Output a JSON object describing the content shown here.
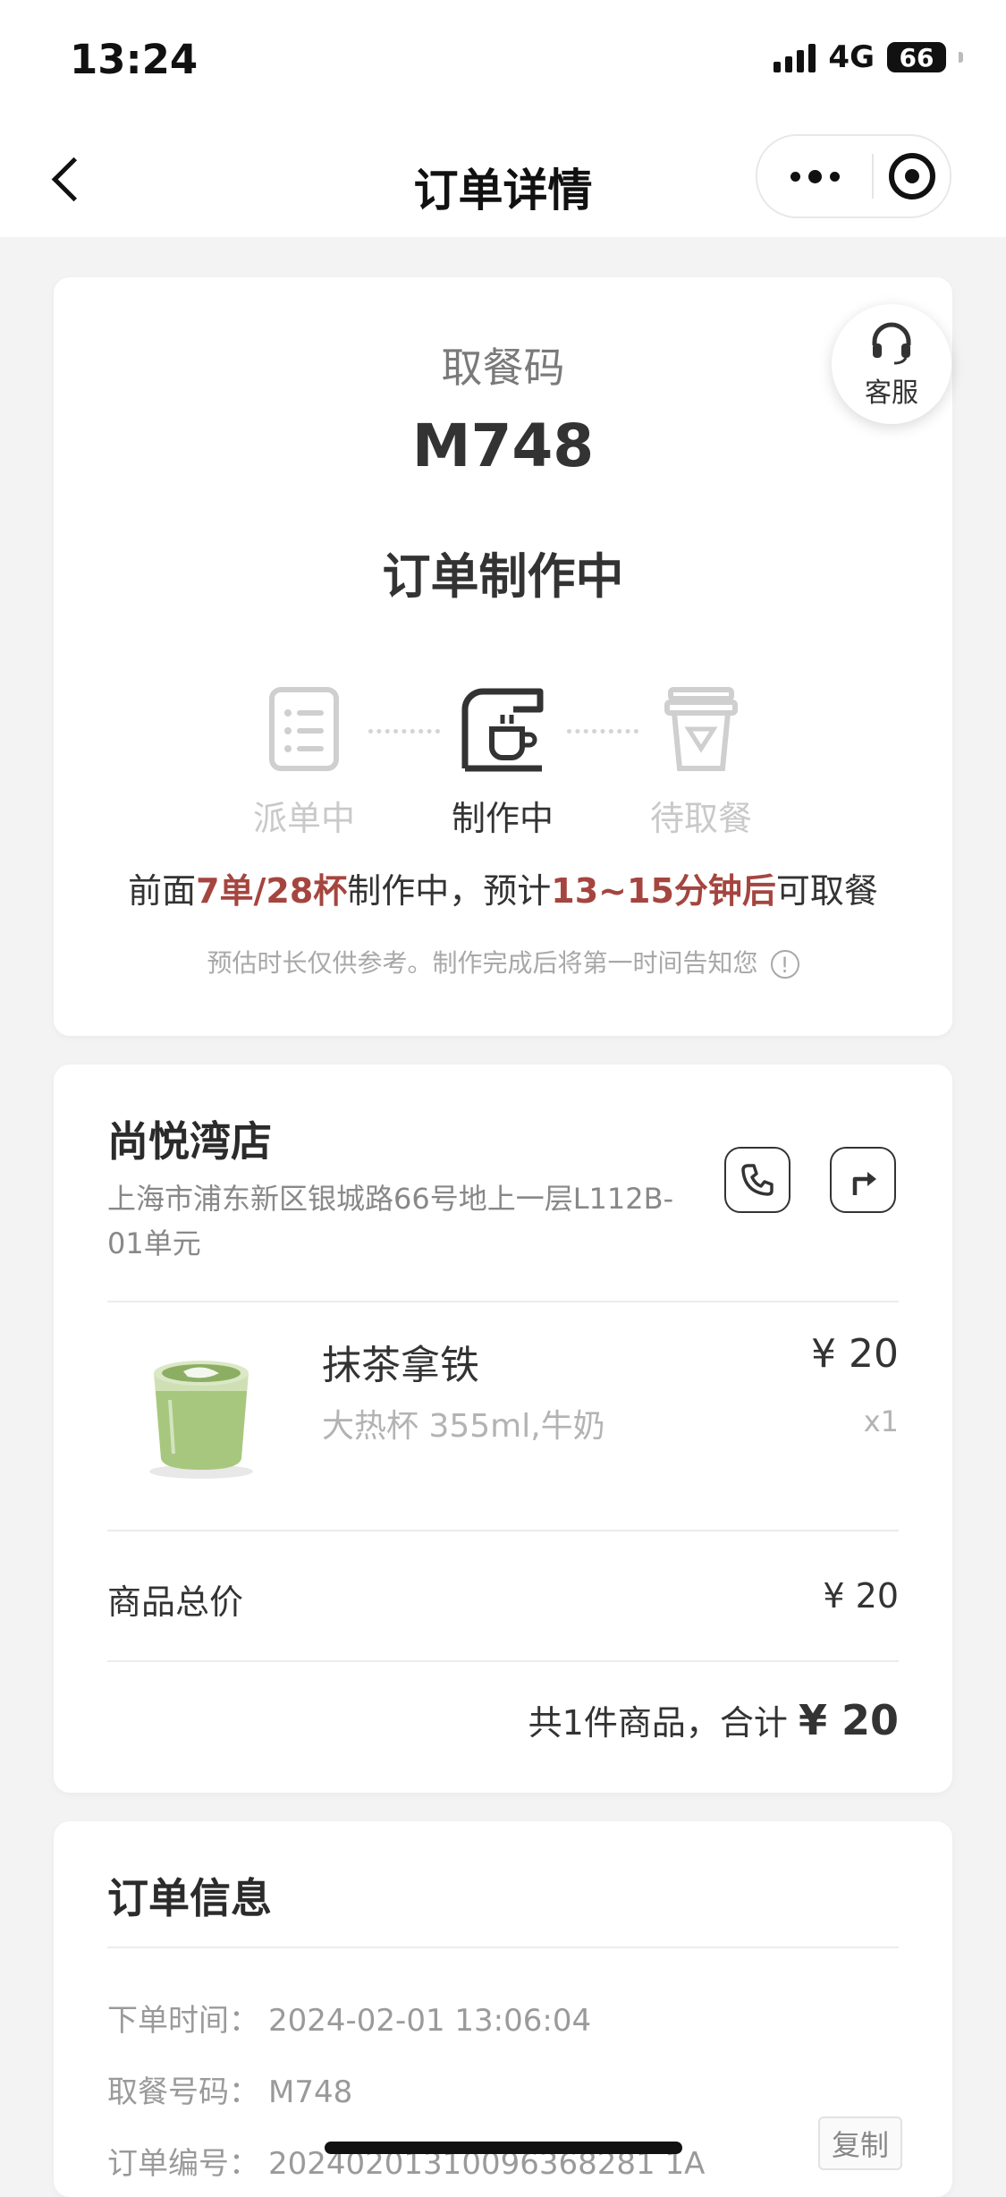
{
  "status_bar": {
    "time": "13:24",
    "network": "4G",
    "battery": "66"
  },
  "nav": {
    "title": "订单详情",
    "back_icon": "chevron-left-icon",
    "more_icon": "more-dots-icon",
    "close_icon": "target-close-icon"
  },
  "pickup": {
    "label": "取餐码",
    "code": "M748",
    "status": "订单制作中",
    "service_label": "客服",
    "service_icon": "headset-icon"
  },
  "steps": [
    {
      "label": "派单中",
      "icon": "order-list-icon",
      "active": false
    },
    {
      "label": "制作中",
      "icon": "coffee-machine-icon",
      "active": true
    },
    {
      "label": "待取餐",
      "icon": "cup-icon",
      "active": false
    }
  ],
  "queue": {
    "prefix": "前面",
    "orders": "7单/28杯",
    "middle": "制作中，预计",
    "eta": "13~15分钟后",
    "suffix": "可取餐",
    "note": "预估时长仅供参考。制作完成后将第一时间告知您",
    "highlight_color": "#a5453f"
  },
  "store": {
    "name": "尚悦湾店",
    "address": "上海市浦东新区银城路66号地上一层L112B-01单元",
    "call_icon": "phone-icon",
    "navigate_icon": "directions-icon"
  },
  "product": {
    "name": "抹茶拿铁",
    "spec": "大热杯 355ml,牛奶",
    "price": "¥ 20",
    "qty": "x1"
  },
  "totals": {
    "label": "商品总价",
    "value": "¥ 20",
    "summary_prefix": "共1件商品，合计",
    "summary_value": "¥ 20"
  },
  "order_info": {
    "title": "订单信息",
    "rows": [
      {
        "key": "下单时间：",
        "value": "2024-02-01 13:06:04"
      },
      {
        "key": "取餐号码：",
        "value": "M748"
      },
      {
        "key": "订单编号：",
        "value": "20240201310096368281 1A"
      }
    ],
    "copy_label": "复制"
  }
}
